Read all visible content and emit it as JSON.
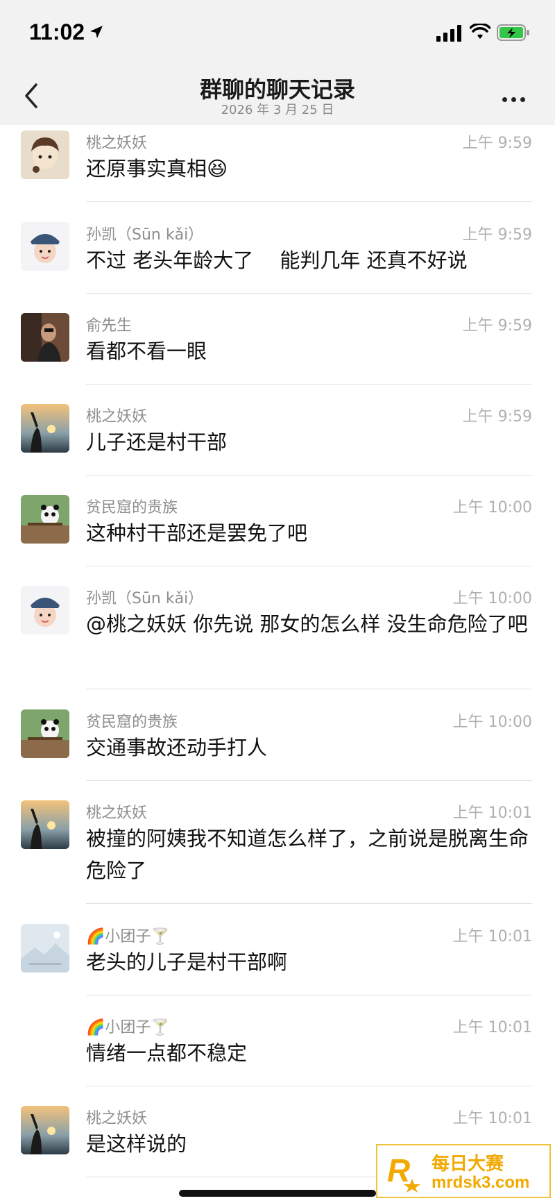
{
  "status_bar": {
    "time": "11:02"
  },
  "nav": {
    "title": "群聊的聊天记录",
    "subtitle": "2026 年 3 月 25 日"
  },
  "messages": [
    {
      "name": "桃之妖妖",
      "time": "上午 9:59",
      "text": "还原事实真相😆",
      "avatar": "cartoon-girl"
    },
    {
      "name": "孙凯（Sūn kǎi）",
      "time": "上午 9:59",
      "text": "不过 老头年龄大了 　能判几年 还真不好说",
      "avatar": "child-photo"
    },
    {
      "name": "俞先生",
      "time": "上午 9:59",
      "text": "看都不看一眼",
      "avatar": "man-photo"
    },
    {
      "name": "桃之妖妖",
      "time": "上午 9:59",
      "text": "儿子还是村干部",
      "avatar": "sunset-girl"
    },
    {
      "name": "贫民窟的贵族",
      "time": "上午 10:00",
      "text": "这种村干部还是罢免了吧",
      "avatar": "panda"
    },
    {
      "name": "孙凯（Sūn kǎi）",
      "time": "上午 10:00",
      "text": "@桃之妖妖 你先说 那女的怎么样 没生命危险了吧",
      "avatar": "child-photo"
    },
    {
      "name": "贫民窟的贵族",
      "time": "上午 10:00",
      "text": "交通事故还动手打人",
      "avatar": "panda"
    },
    {
      "name": "桃之妖妖",
      "time": "上午 10:01",
      "text": "被撞的阿姨我不知道怎么样了，之前说是脱离生命危险了",
      "avatar": "sunset-girl"
    },
    {
      "name": "🌈小团子🍸",
      "time": "上午 10:01",
      "text": "老头的儿子是村干部啊",
      "avatar": "landscape-placeholder"
    },
    {
      "name": "🌈小团子🍸",
      "time": "上午 10:01",
      "text": "情绪一点都不稳定",
      "avatar": ""
    },
    {
      "name": "桃之妖妖",
      "time": "上午 10:01",
      "text": "是这样说的",
      "avatar": "sunset-girl"
    }
  ],
  "watermark": {
    "line1": "每日大赛",
    "line2": "mrdsk3.com",
    "logo_letter": "R"
  }
}
